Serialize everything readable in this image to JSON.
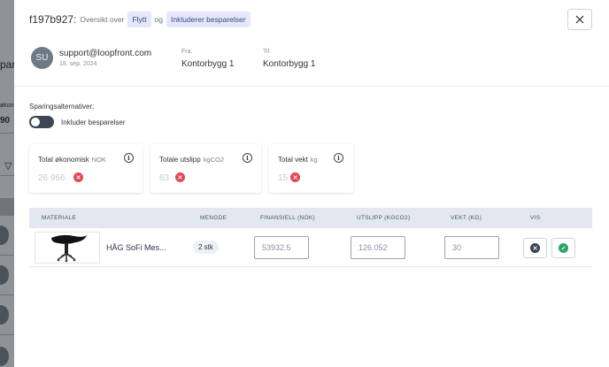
{
  "background": {
    "fragment_top": "par",
    "fragment_mid1": "økon",
    "fragment_mid2": "90"
  },
  "modal": {
    "title_id": "f197b927:",
    "title_sub": "Oversikt over",
    "chip_move": "Flytt",
    "title_conn": "og",
    "chip_savings": "Inkluderer besparelser",
    "close_icon": "close-icon"
  },
  "user": {
    "initials": "SU",
    "email": "support@loopfront.com",
    "date": "18. sep. 2024",
    "from_label": "Fra:",
    "from_value": "Kontorbygg 1",
    "to_label": "Til:",
    "to_value": "Kontorbygg 1"
  },
  "savings": {
    "title": "Sparingsalternativer:",
    "toggle_label": "Inkluder besparelser",
    "toggle_on": false
  },
  "cards": [
    {
      "label": "Total økonomisk",
      "unit": "NOK",
      "value": "26 966",
      "info_icon": "info-icon",
      "status_icon": "x-circle-icon"
    },
    {
      "label": "Totale utslipp",
      "unit": "kgCO2",
      "value": "63",
      "info_icon": "info-icon",
      "status_icon": "x-circle-icon"
    },
    {
      "label": "Total vekt",
      "unit": "kg",
      "value": "15",
      "info_icon": "info-icon",
      "status_icon": "x-circle-icon"
    }
  ],
  "table": {
    "headers": [
      "MATERIALE",
      "MENGDE",
      "FINANSIELL (NOK)",
      "UTSLIPP (KGCO2)",
      "VEKT (KG)",
      "VIS"
    ],
    "rows": [
      {
        "name": "HÅG SoFi Mes...",
        "qty": "2 stk",
        "financial": "53932.5",
        "emission": "126.052",
        "weight": "30",
        "reject_icon": "x-circle-icon",
        "accept_icon": "check-circle-icon"
      }
    ]
  },
  "colors": {
    "accent_chip_bg": "#e4e8f8",
    "danger": "#e8464e",
    "success": "#2aa36b",
    "table_header_bg": "#e3e8f0"
  }
}
